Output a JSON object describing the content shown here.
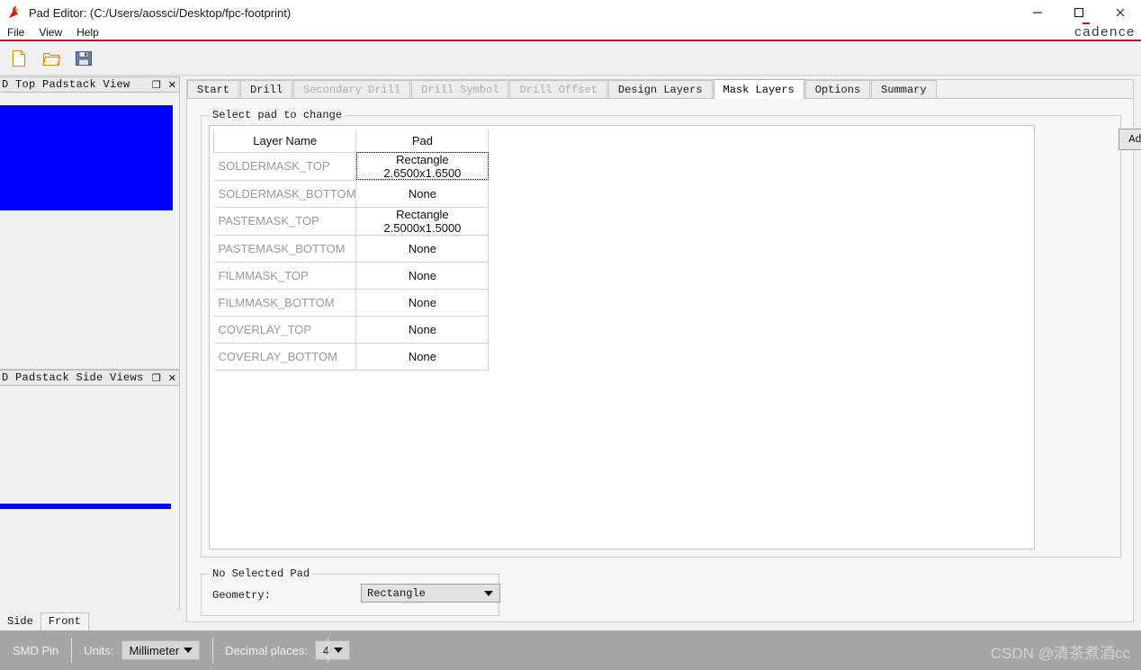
{
  "window": {
    "app_icon": "pad-editor-icon",
    "title": "Pad Editor:  (C:/Users/aossci/Desktop/fpc-footprint)",
    "minimize": "–",
    "maximize": "□",
    "close": "✕",
    "brand": "cadence"
  },
  "menubar": {
    "items": [
      {
        "label": "File"
      },
      {
        "label": "View"
      },
      {
        "label": "Help"
      }
    ]
  },
  "toolbar": {
    "buttons": [
      {
        "name": "new-file-icon"
      },
      {
        "name": "open-folder-icon"
      },
      {
        "name": "save-icon"
      }
    ]
  },
  "dock": {
    "top_panel": {
      "title": "D Top Padstack View",
      "float_button": "❐",
      "close_button": "✕"
    },
    "bottom_panel": {
      "title": "D Padstack Side Views",
      "float_button": "❐",
      "close_button": "✕"
    },
    "view_tabs": [
      {
        "label": "Side",
        "selected": false
      },
      {
        "label": "Front",
        "selected": true
      }
    ],
    "pad_color": "#0000ff"
  },
  "tabs": [
    {
      "label": "Start",
      "state": "enabled"
    },
    {
      "label": "Drill",
      "state": "enabled"
    },
    {
      "label": "Secondary Drill",
      "state": "disabled"
    },
    {
      "label": "Drill Symbol",
      "state": "disabled"
    },
    {
      "label": "Drill Offset",
      "state": "disabled"
    },
    {
      "label": "Design Layers",
      "state": "enabled"
    },
    {
      "label": "Mask Layers",
      "state": "active"
    },
    {
      "label": "Options",
      "state": "enabled"
    },
    {
      "label": "Summary",
      "state": "enabled"
    }
  ],
  "select_pad_group": {
    "label": "Select pad to change",
    "add_layer_button": "Add Layer",
    "table": {
      "columns": [
        "Layer Name",
        "Pad"
      ],
      "rows": [
        {
          "layer": "SOLDERMASK_TOP",
          "pad": "Rectangle 2.6500x1.6500",
          "focused": true
        },
        {
          "layer": "SOLDERMASK_BOTTOM",
          "pad": "None",
          "focused": false
        },
        {
          "layer": "PASTEMASK_TOP",
          "pad": "Rectangle 2.5000x1.5000",
          "focused": false
        },
        {
          "layer": "PASTEMASK_BOTTOM",
          "pad": "None",
          "focused": false
        },
        {
          "layer": "FILMMASK_TOP",
          "pad": "None",
          "focused": false
        },
        {
          "layer": "FILMMASK_BOTTOM",
          "pad": "None",
          "focused": false
        },
        {
          "layer": "COVERLAY_TOP",
          "pad": "None",
          "focused": false
        },
        {
          "layer": "COVERLAY_BOTTOM",
          "pad": "None",
          "focused": false
        }
      ]
    }
  },
  "selected_pad_group": {
    "label": "No Selected Pad",
    "geometry_label": "Geometry:",
    "geometry_value": "Rectangle"
  },
  "statusbar": {
    "pin_type": "SMD Pin",
    "units_label": "Units:",
    "units_value": "Millimeter",
    "decimal_label": "Decimal places:",
    "decimal_value": "4",
    "watermark": "CSDN @清茶煮酒cc"
  }
}
